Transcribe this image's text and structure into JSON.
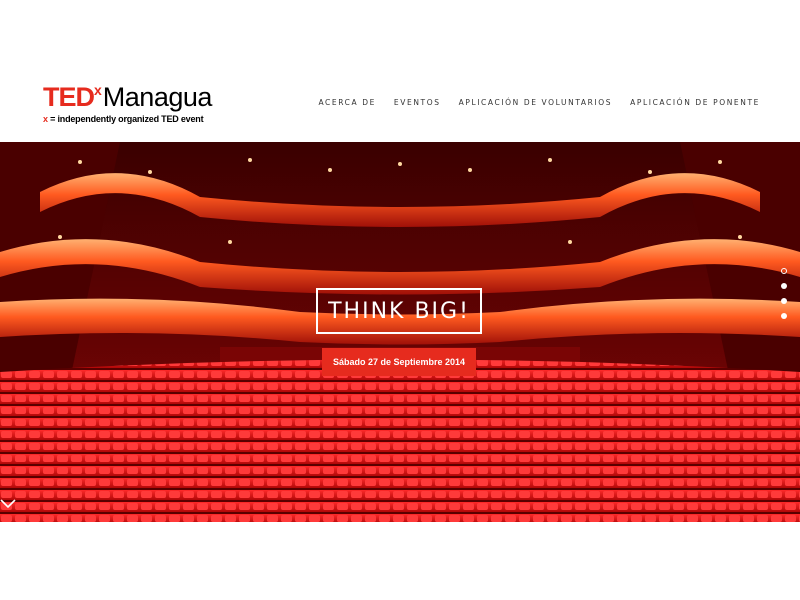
{
  "header": {
    "logo": {
      "ted": "TED",
      "x": "x",
      "city": "Managua",
      "tagline_x": "x",
      "tagline_rest": " = independently organized TED event"
    },
    "nav": [
      "ACERCA DE",
      "EVENTOS",
      "APLICACIÓN DE VOLUNTARIOS",
      "APLICACIÓN DE PONENTE"
    ]
  },
  "hero": {
    "headline": "THINK BIG!",
    "date": "Sábado 27 de Septiembre 2014",
    "slider": {
      "count": 4,
      "active_index": 0
    },
    "scroll_icon": "chevron-down-icon"
  },
  "colors": {
    "brand_red": "#e62b1e",
    "text_dark": "#333333"
  }
}
